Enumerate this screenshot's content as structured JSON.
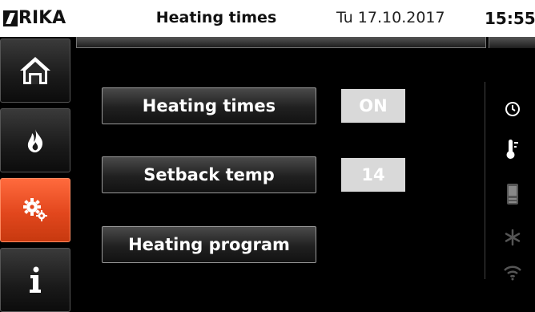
{
  "header": {
    "logo_text": "RIKA",
    "title": "Heating times",
    "date": "Tu 17.10.2017",
    "time": "15:55"
  },
  "sidebar": {
    "items": [
      {
        "icon": "home-icon",
        "active": false
      },
      {
        "icon": "flame-icon",
        "active": false
      },
      {
        "icon": "settings-gears-icon",
        "active": true
      },
      {
        "icon": "info-icon",
        "active": false
      }
    ]
  },
  "main": {
    "rows": [
      {
        "label": "Heating times",
        "value": "ON"
      },
      {
        "label": "Setback temp",
        "value": "14"
      },
      {
        "label": "Heating program",
        "value": ""
      }
    ]
  },
  "status_icons": [
    "clock-icon",
    "thermometer-icon",
    "device-icon",
    "snowflake-icon",
    "wifi-icon"
  ],
  "colors": {
    "accent": "#e2471d",
    "value_box": "#d9d9d9",
    "background": "#000000"
  }
}
